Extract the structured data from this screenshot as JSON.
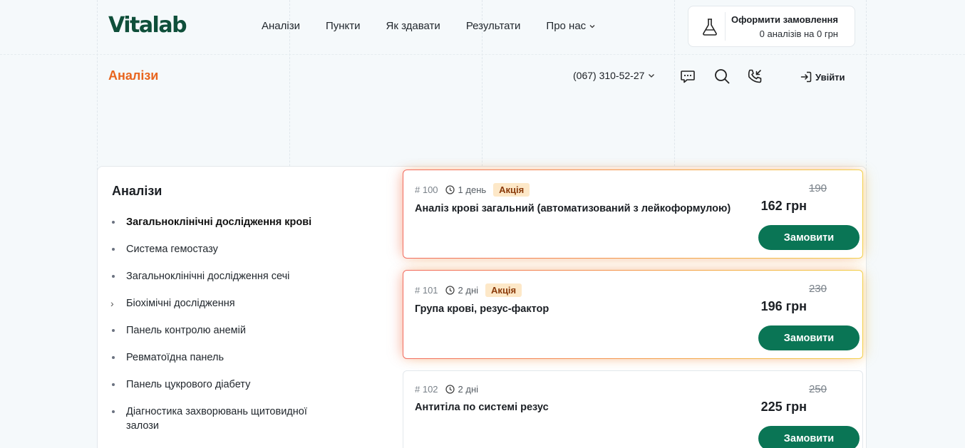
{
  "header": {
    "logo": "Vitalab",
    "nav": [
      {
        "label": "Аналізи"
      },
      {
        "label": "Пункти"
      },
      {
        "label": "Як здавати"
      },
      {
        "label": "Результати"
      },
      {
        "label": "Про нас"
      }
    ],
    "order": {
      "title": "Оформити замовлення",
      "summary": "0 аналізів на 0 грн"
    }
  },
  "subheader": {
    "page_title": "Аналізи",
    "phone": "(067) 310-52-27",
    "login": "Увійти"
  },
  "sidebar": {
    "title": "Аналізи",
    "items": [
      {
        "label": "Загальноклінічні дослідження крові",
        "active": true
      },
      {
        "label": "Система гемостазу"
      },
      {
        "label": "Загальноклінічні дослідження сечі"
      },
      {
        "label": "Біохімічні дослідження",
        "expandable": true
      },
      {
        "label": "Панель контролю анемій"
      },
      {
        "label": "Ревматоїдна панель"
      },
      {
        "label": "Панель цукрового діабету"
      },
      {
        "label": "Діагностика захворювань щитовидної залози"
      }
    ]
  },
  "products": [
    {
      "code": "# 100",
      "duration": "1 день",
      "badge": "Акція",
      "name": "Аналіз крові загальний (автоматизований з лейкоформулою)",
      "old_price": "190",
      "price": "162 грн",
      "button": "Замовити"
    },
    {
      "code": "# 101",
      "duration": "2 дні",
      "badge": "Акція",
      "name": "Група крові, резус-фактор",
      "old_price": "230",
      "price": "196 грн",
      "button": "Замовити"
    },
    {
      "code": "# 102",
      "duration": "2 дні",
      "badge": "",
      "name": "Антитіла по системі резус",
      "old_price": "250",
      "price": "225 грн",
      "button": "Замовити"
    }
  ],
  "colors": {
    "brand": "#0f4f3a",
    "accent": "#e8651e",
    "button": "#0a7555",
    "badge_bg": "#fde8c8"
  }
}
